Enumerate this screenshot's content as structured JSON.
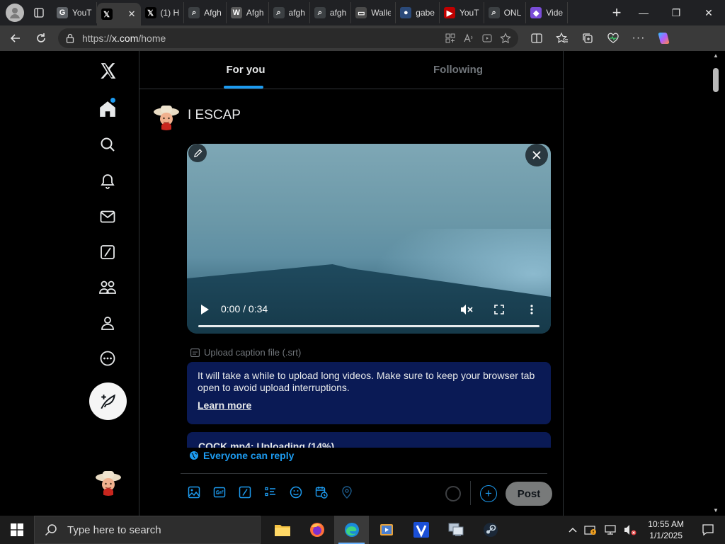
{
  "browser": {
    "tabs": [
      {
        "label": "YouT",
        "icon": "google-icon",
        "color": "#5f6368",
        "active": false
      },
      {
        "label": "",
        "icon": "x-logo-icon",
        "color": "#000000",
        "active": true
      },
      {
        "label": "(1) H",
        "icon": "x-logo-icon",
        "color": "#000000",
        "active": false
      },
      {
        "label": "Afgh",
        "icon": "search-icon",
        "color": "#3c4043",
        "active": false
      },
      {
        "label": "Afgh",
        "icon": "wikipedia-icon",
        "color": "#5a5a5a",
        "active": false
      },
      {
        "label": "afgh",
        "icon": "search-icon",
        "color": "#3c4043",
        "active": false
      },
      {
        "label": "afgh",
        "icon": "search-icon",
        "color": "#3c4043",
        "active": false
      },
      {
        "label": "Walle",
        "icon": "wallet-icon",
        "color": "#4a4a4a",
        "active": false
      },
      {
        "label": "gabe",
        "icon": "globe-icon",
        "color": "#2b4a7a",
        "active": false
      },
      {
        "label": "YouT",
        "icon": "youtube-icon",
        "color": "#c00000",
        "active": false
      },
      {
        "label": "ONL",
        "icon": "search-icon",
        "color": "#3c4043",
        "active": false
      },
      {
        "label": "Vide",
        "icon": "copilot-icon",
        "color": "#7a4dd8",
        "active": false
      }
    ],
    "url_prefix": "https://",
    "url_domain": "x.com",
    "url_path": "/home"
  },
  "x": {
    "feed_tabs": {
      "for_you": "For you",
      "following": "Following"
    },
    "composer": {
      "text": "I ESCAP",
      "video_time": "0:00 / 0:34",
      "video_progress": 0.0,
      "caption_link": "Upload caption file (.srt)",
      "notice": "It will take a while to upload long videos. Make sure to keep your browser tab open to avoid upload interruptions.",
      "learn_more": "Learn more",
      "upload_status": "COCK.mp4: Uploading (14%)",
      "upload_percent": 14,
      "reply_setting": "Everyone can reply",
      "post_label": "Post"
    },
    "accent": "#1d9bf0"
  },
  "taskbar": {
    "search_placeholder": "Type here to search",
    "time": "10:55 AM",
    "date": "1/1/2025"
  }
}
